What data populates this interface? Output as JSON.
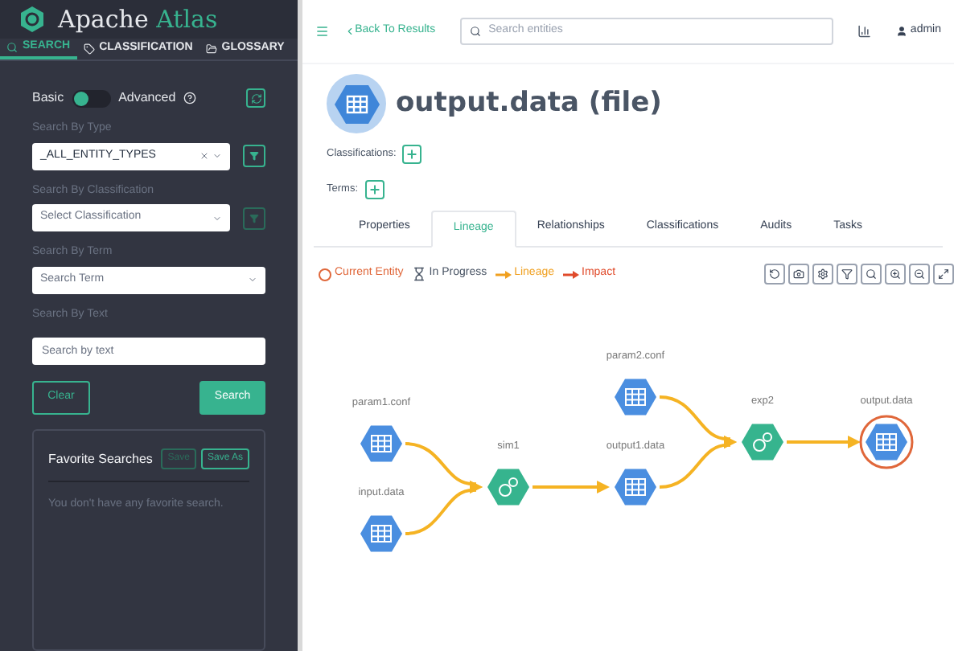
{
  "brand": {
    "name_part_1": "Apache",
    "name_part_2": "Atlas"
  },
  "sidebar_tabs": [
    {
      "label": "SEARCH",
      "selected": true
    },
    {
      "label": "CLASSIFICATION",
      "selected": false
    },
    {
      "label": "GLOSSARY",
      "selected": false
    }
  ],
  "mode_toggle": {
    "left_label": "Basic",
    "right_label": "Advanced",
    "on": false
  },
  "filters": [
    {
      "label": "Search By Type",
      "value": "_ALL_ENTITY_TYPES",
      "clearable": true,
      "filter_enabled": true
    },
    {
      "label": "Search By Classification",
      "placeholder": "Select Classification",
      "clearable": false,
      "filter_enabled": false
    },
    {
      "label": "Search By Term",
      "placeholder": "Search Term",
      "clearable": false
    }
  ],
  "text_search": {
    "label": "Search By Text",
    "placeholder": "Search by text"
  },
  "buttons": {
    "clear": "Clear",
    "search": "Search"
  },
  "favorites": {
    "title": "Favorite Searches",
    "save": "Save",
    "save_as": "Save As",
    "empty_message": "You don't have any favorite search."
  },
  "topbar": {
    "back": "Back To Results",
    "search_placeholder": "Search entities",
    "user": "admin"
  },
  "entity": {
    "title": "output.data (file)",
    "classifications_label": "Classifications:",
    "terms_label": "Terms:"
  },
  "tabs": [
    {
      "label": "Properties",
      "selected": false
    },
    {
      "label": "Lineage",
      "selected": true
    },
    {
      "label": "Relationships",
      "selected": false
    },
    {
      "label": "Classifications",
      "selected": false
    },
    {
      "label": "Audits",
      "selected": false
    },
    {
      "label": "Tasks",
      "selected": false
    }
  ],
  "legend": [
    {
      "kind": "current",
      "label": "Current Entity"
    },
    {
      "kind": "progress",
      "label": "In Progress"
    },
    {
      "kind": "lineage",
      "label": "Lineage"
    },
    {
      "kind": "impact",
      "label": "Impact"
    }
  ],
  "lineage_nodes": [
    {
      "label": "param1.conf",
      "kind": "dataset",
      "current": false
    },
    {
      "label": "input.data",
      "kind": "dataset",
      "current": false
    },
    {
      "label": "sim1",
      "kind": "process",
      "current": false
    },
    {
      "label": "output1.data",
      "kind": "dataset",
      "current": false
    },
    {
      "label": "param2.conf",
      "kind": "dataset",
      "current": false
    },
    {
      "label": "exp2",
      "kind": "process",
      "current": false
    },
    {
      "label": "output.data",
      "kind": "dataset",
      "current": true
    }
  ]
}
